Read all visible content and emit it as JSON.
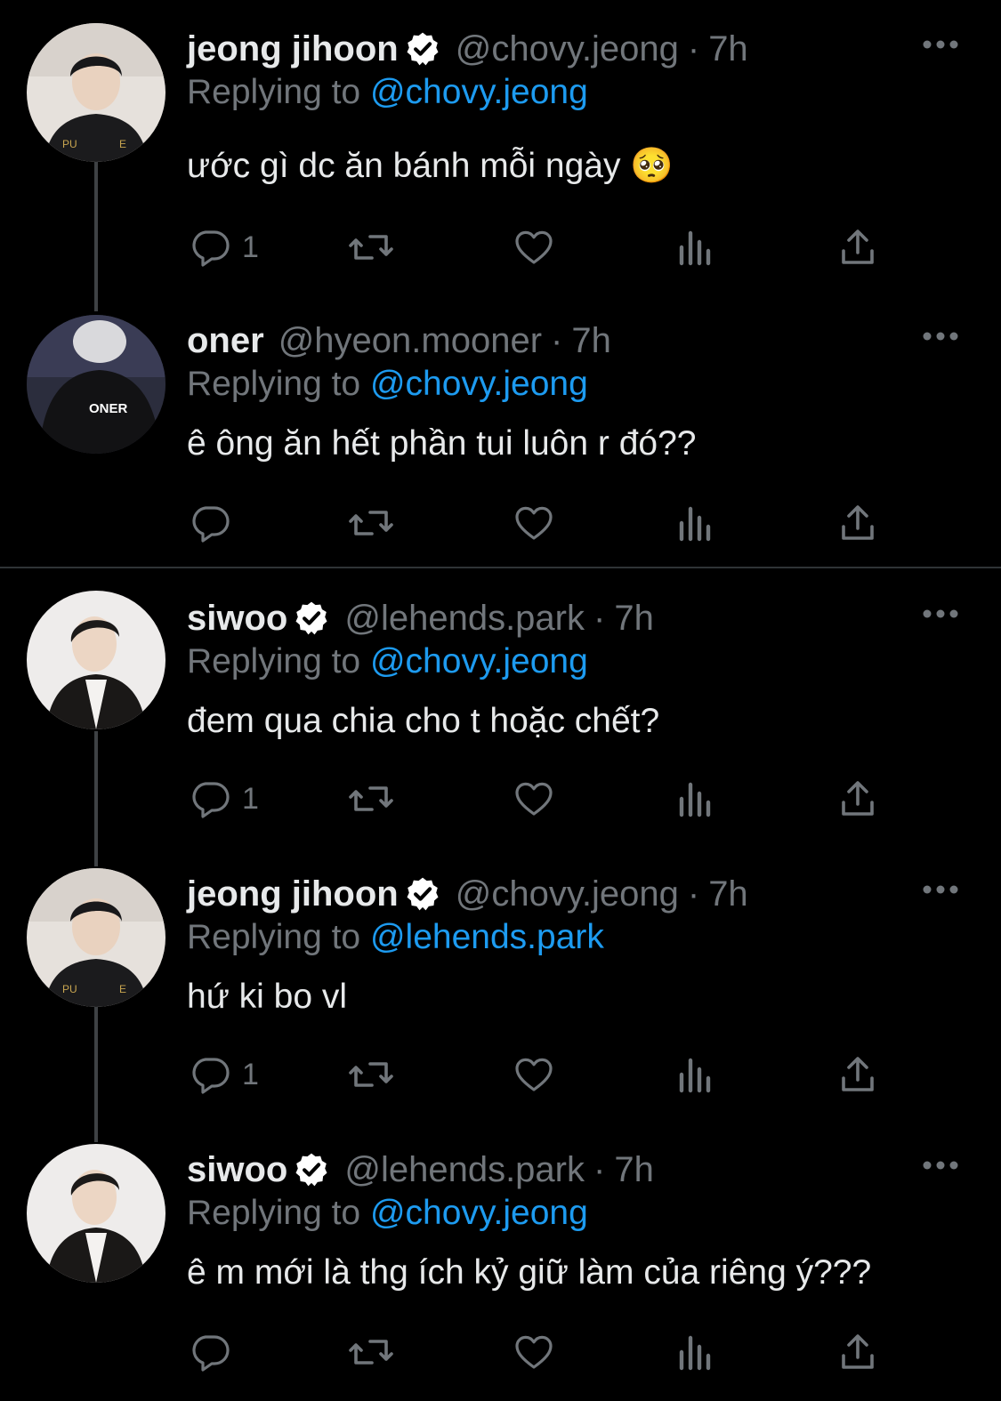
{
  "tweets": [
    {
      "name": "jeong jihoon",
      "verified": true,
      "handle": "@chovy.jeong",
      "dot": "·",
      "time": "7h",
      "replying_prefix": "Replying to",
      "replying_to": "@chovy.jeong",
      "text": "ước gì dc ăn bánh mỗi ngày 🥺",
      "reply_count": "1",
      "avatar_icon": "profile-photo"
    },
    {
      "name": "oner",
      "verified": false,
      "handle": "@hyeon.mooner",
      "dot": "·",
      "time": "7h",
      "replying_prefix": "Replying to",
      "replying_to": "@chovy.jeong",
      "text": "ê ông ăn hết phần tui luôn r đó??",
      "reply_count": "",
      "avatar_icon": "profile-photo",
      "avatar_jersey_text": "ONER"
    },
    {
      "name": "siwoo",
      "verified": true,
      "handle": "@lehends.park",
      "dot": "·",
      "time": "7h",
      "replying_prefix": "Replying to",
      "replying_to": "@chovy.jeong",
      "text": "đem qua chia cho t hoặc chết?",
      "reply_count": "1",
      "avatar_icon": "profile-photo"
    },
    {
      "name": "jeong jihoon",
      "verified": true,
      "handle": "@chovy.jeong",
      "dot": "·",
      "time": "7h",
      "replying_prefix": "Replying to",
      "replying_to": "@lehends.park",
      "text": "hứ ki bo vl",
      "reply_count": "1",
      "avatar_icon": "profile-photo"
    },
    {
      "name": "siwoo",
      "verified": true,
      "handle": "@lehends.park",
      "dot": "·",
      "time": "7h",
      "replying_prefix": "Replying to",
      "replying_to": "@chovy.jeong",
      "text": "ê m mới là thg ích kỷ giữ làm của riêng ý???",
      "reply_count": "",
      "avatar_icon": "profile-photo"
    }
  ],
  "icons": {
    "reply": "reply-icon",
    "retweet": "retweet-icon",
    "like": "heart-icon",
    "views": "views-icon",
    "share": "share-icon",
    "more": "more-icon",
    "verified": "verified-badge-icon"
  },
  "colors": {
    "background": "#000000",
    "text": "#e7e9ea",
    "secondary": "#71767b",
    "link": "#1d9bf0",
    "connector": "#3e4144"
  }
}
